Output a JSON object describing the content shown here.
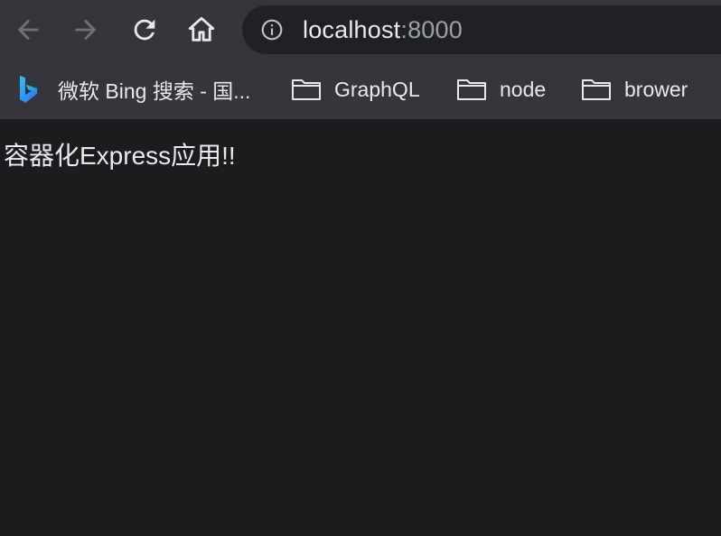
{
  "browser": {
    "url_host": "localhost",
    "url_port": ":8000",
    "icons": {
      "back": "arrow-left-icon",
      "forward": "arrow-right-icon",
      "reload": "reload-icon",
      "home": "home-icon",
      "site_info": "info-icon"
    }
  },
  "bookmarks": [
    {
      "label": "微软 Bing 搜索 - 国...",
      "icon": "bing-logo-icon"
    },
    {
      "label": "GraphQL",
      "icon": "folder-icon"
    },
    {
      "label": "node",
      "icon": "folder-icon"
    },
    {
      "label": "brower",
      "icon": "folder-icon"
    }
  ],
  "page": {
    "body_text": "容器化Express应用!!"
  },
  "colors": {
    "toolbar_bg": "#35363a",
    "omnibox_bg": "#202124",
    "page_bg": "#1b1c1e",
    "text": "#e8eaed",
    "muted_text": "#9aa0a6"
  }
}
